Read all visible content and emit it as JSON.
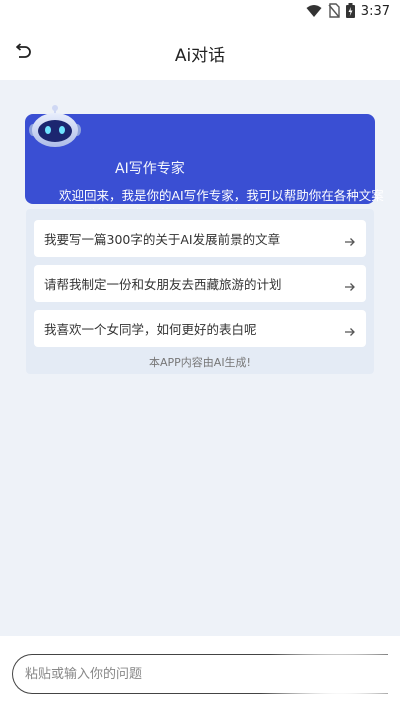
{
  "status_bar": {
    "time": "3:37",
    "icons": [
      "wifi-icon",
      "no-sim-icon",
      "battery-icon"
    ]
  },
  "header": {
    "title": "Ai对话",
    "back_icon": "back-icon"
  },
  "intro": {
    "name": "AI写作专家",
    "message": "欢迎回来，我是你的AI写作专家，我可以帮助你在各种文案上提供指导，你有什么问题与我探讨吗?",
    "avatar": "robot-icon"
  },
  "prompts": [
    {
      "label": "我要写一篇300字的关于AI发展前景的文章"
    },
    {
      "label": "请帮我制定一份和女朋友去西藏旅游的计划"
    },
    {
      "label": "我喜欢一个女同学，如何更好的表白呢"
    }
  ],
  "disclaimer": "本APP内容由AI生成!",
  "input": {
    "placeholder": "粘贴或输入你的问题",
    "value": ""
  },
  "colors": {
    "accent": "#3a4fd3",
    "background": "#eef2f8",
    "panel": "#e4ebf5"
  }
}
